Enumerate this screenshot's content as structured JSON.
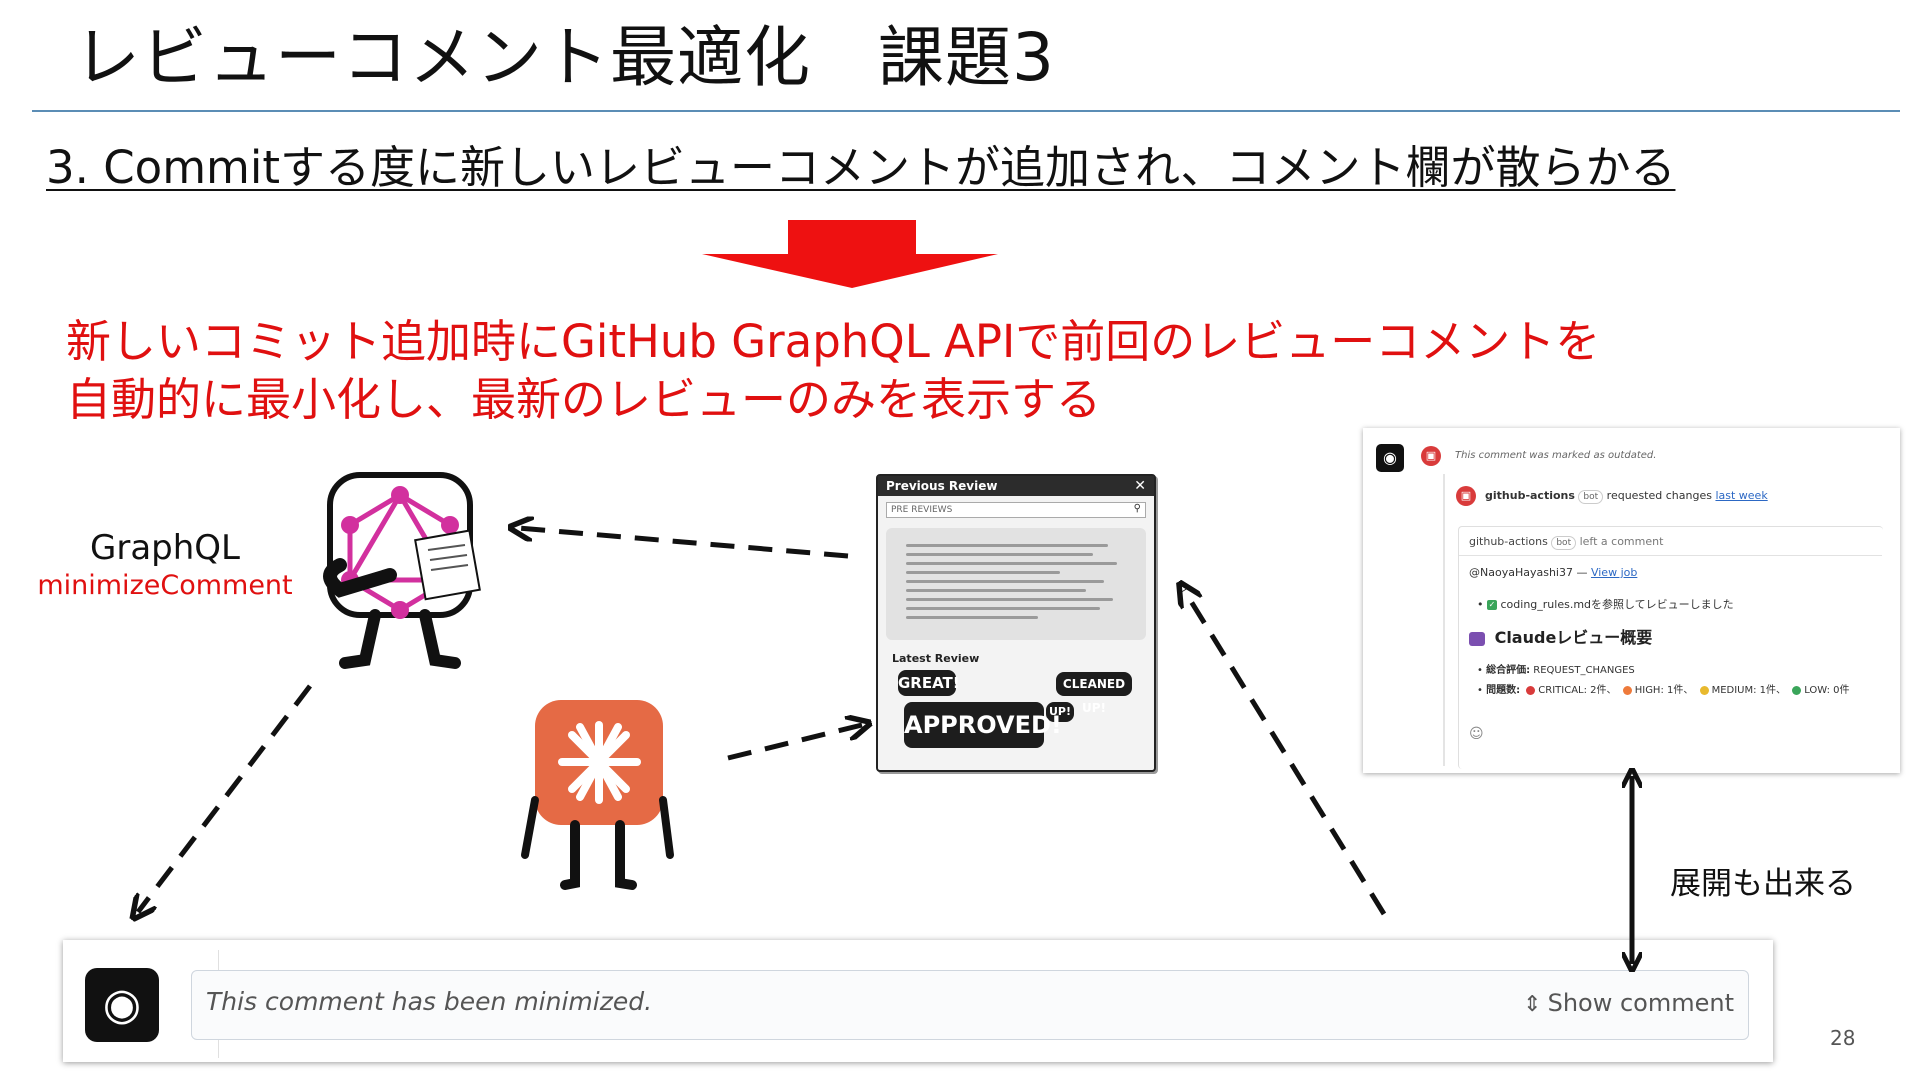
{
  "slide": {
    "title": "レビューコメント最適化　課題3",
    "problem": "3. Commitする度に新しいレビューコメントが追加され、コメント欄が散らかる",
    "solution_line1": "新しいコミット追加時にGitHub GraphQL APIで前回のレビューコメントを",
    "solution_line2": "自動的に最小化し、最新のレビューのみを表示する",
    "graphql_label": "GraphQL",
    "graphql_mutation": "minimizeComment",
    "expand_label": "展開も出来る",
    "page_number": "28"
  },
  "colors": {
    "accent_red": "#e01010",
    "title_rule": "#5b8db5",
    "link_blue": "#2c68c4"
  },
  "review_card": {
    "title": "Previous Review",
    "search_placeholder": "PRE REVIEWS",
    "latest_label": "Latest Review",
    "bubble_great": "GREAT!",
    "bubble_cleaned": "CLEANED UP!",
    "bubble_up": "UP!",
    "bubble_approved": "APPROVED!"
  },
  "gh_panel": {
    "outdated_note": "This comment was marked as outdated.",
    "actor": "github-actions",
    "bot_tag": "bot",
    "action_text": "requested changes",
    "action_time": "last week",
    "comment_actor": "github-actions",
    "comment_bot_tag": "bot",
    "comment_action": "left a comment",
    "mention": "@NaoyaHayashi37",
    "dash": "—",
    "view_job": "View job",
    "task_item": "coding_rules.mdを参照してレビューしました",
    "summary_heading": "Claudeレビュー概要",
    "overall_label": "総合評価:",
    "overall_value": "REQUEST_CHANGES",
    "issues_label": "問題数:",
    "critical": "CRITICAL: 2件、",
    "high": "HIGH: 1件、",
    "medium": "MEDIUM: 1件、",
    "low": "LOW: 0件",
    "severity_colors": {
      "critical": "#d93b3b",
      "high": "#ee7a3b",
      "medium": "#e8b92e",
      "low": "#3aa55a"
    }
  },
  "minimized_bar": {
    "text": "This comment has been minimized.",
    "show_label": "Show comment"
  }
}
